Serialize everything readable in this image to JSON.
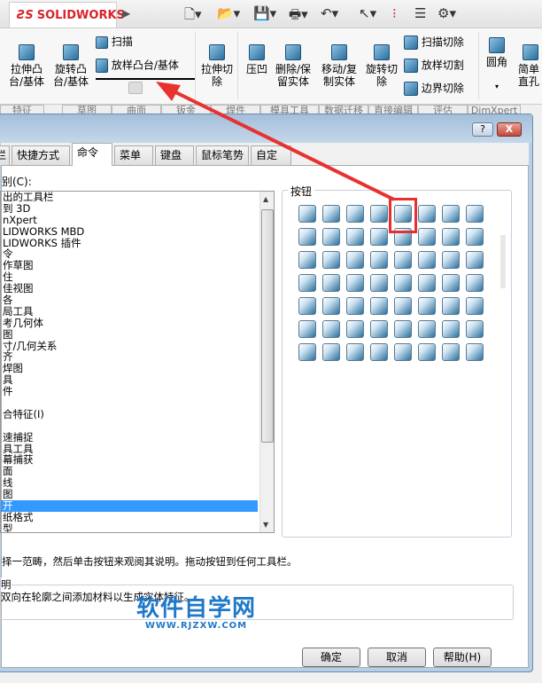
{
  "app": {
    "logo": "SOLIDWORKS"
  },
  "toolbar": {
    "icons": [
      "new-document-icon",
      "open-icon",
      "save-icon",
      "print-icon",
      "undo-icon",
      "select-cursor-icon",
      "traffic-light-icon",
      "file-properties-icon",
      "options-gear-icon"
    ]
  },
  "ribbon": {
    "extrude_boss": "拉伸凸台/基体",
    "revolve_boss": "旋转凸台/基体",
    "sweep": "扫描",
    "loft_boss": "放样凸台/基体",
    "extrude_cut": "拉伸切除",
    "indent": "压凹",
    "delete_body": "删除/保留实体",
    "move_body": "移动/复制实体",
    "revolve_cut": "旋转切除",
    "sweep_cut": "扫描切除",
    "loft_cut": "放样切割",
    "boundary_cut": "边界切除",
    "fillet": "圆角",
    "hole": "简单直孔"
  },
  "command_tabs": [
    "特征",
    "草图",
    "曲面",
    "钣金",
    "焊件",
    "模具工具",
    "数据迁移",
    "直接编辑",
    "评估",
    "DimXpert"
  ],
  "dialog": {
    "help_button": "?",
    "close_button": "X",
    "tabs": [
      "栏",
      "快捷方式栏",
      "命令",
      "菜单",
      "键盘",
      "鼠标笔势",
      "自定义"
    ],
    "category_label": "别(C):",
    "categories": [
      "出的工具栏",
      "到 3D",
      "nXpert",
      "LIDWORKS MBD",
      "LIDWORKS 插件",
      "令",
      "作草图",
      "住",
      "佳视图",
      "各",
      "局工具",
      "考几何体",
      "图",
      "寸/几何关系",
      "齐",
      "焊图",
      "具",
      "件",
      "",
      "合特征(I)",
      "",
      "速捕捉",
      "具工具",
      "幕捕获",
      "面",
      "线",
      "图",
      "开",
      "纸格式",
      "型"
    ],
    "selected_index": 27,
    "buttons_label": "按钮",
    "button_icons": [
      "extrude-boss-icon",
      "revolve-boss-icon",
      "sweep-icon",
      "loft-boss-icon",
      "boundary-boss-icon",
      "thicken-icon",
      "extrude-cut-icon",
      "revolve-cut-icon",
      "sweep-cut-icon",
      "loft-cut-icon",
      "boundary-cut-icon",
      "thicken-cut-icon",
      "cut-with-surface-icon",
      "fillet-icon",
      "chamfer-icon",
      "rib-icon",
      "scale-icon",
      "shell-icon",
      "draft-icon",
      "intersect-icon",
      "simple-hole-icon",
      "hole-wizard-icon",
      "cosmetic-thread-icon",
      "advanced-hole-icon",
      "dome-icon",
      "flex-icon",
      "wrap-icon",
      "deform-icon",
      "freeform-icon",
      "indent-icon",
      "combine-icon",
      "split-icon",
      "measure-icon",
      "move-face-down-icon",
      "move-face-up-icon",
      "copy-face-icon",
      "linear-pattern-icon",
      "circular-pattern-icon",
      "mirror-icon",
      "curve-pattern-icon",
      "sketch-pattern-icon",
      "table-pattern-icon",
      "fill-pattern-icon",
      "variable-pattern-icon",
      "split-part-icon",
      "insert-part-icon",
      "join-icon",
      "cavity-icon",
      "delete-body-icon",
      "replace-body-icon",
      "save-bodies-icon",
      "insert-into-new-part-icon",
      "move-copy-body-icon",
      "feature-tree-icon",
      "check-icon",
      "3d-grid-icon"
    ],
    "hint": "择一范畴，然后单击按钮来观阅其说明。拖动按钮到任何工具栏。",
    "description_label": "明",
    "description": "双向在轮廓之间添加材料以生成实体特征。",
    "ok": "确定",
    "cancel": "取消",
    "help": "帮助(H)"
  },
  "watermark": {
    "title": "软件自学网",
    "url": "WWW.RJZXW.COM"
  }
}
